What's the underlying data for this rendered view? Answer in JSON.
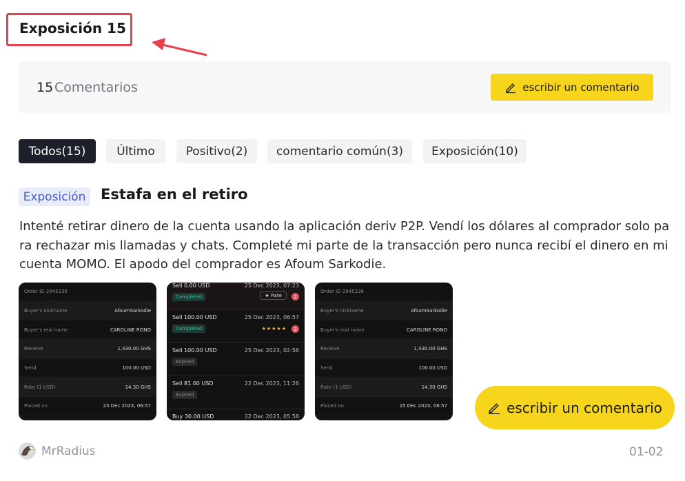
{
  "header": {
    "title": "Exposición 15"
  },
  "summary": {
    "count": "15",
    "count_label": "Comentarios",
    "write_button": "escribir un comentario"
  },
  "tabs": [
    {
      "label": "Todos(15)",
      "active": true
    },
    {
      "label": "Último",
      "active": false
    },
    {
      "label": "Positivo(2)",
      "active": false
    },
    {
      "label": "comentario común(3)",
      "active": false
    },
    {
      "label": "Exposición(10)",
      "active": false
    }
  ],
  "review": {
    "badge": "Exposición",
    "title": "Estafa en el retiro",
    "body": "Intenté retirar dinero de la cuenta usando la aplicación deriv P2P. Vendí los dólares al comprador solo para rechazar mis llamadas y chats. Completé mi parte de la transacción pero nunca recibí el dinero en mi cuenta MOMO. El apodo del comprador es Afoum Sarkodie.",
    "author": "MrRadius",
    "date": "01-02"
  },
  "screenshots": {
    "detail": {
      "header": "Order ID 2945336",
      "rows": [
        {
          "k": "Buyer's nickname",
          "v": "AfoumSarkodie"
        },
        {
          "k": "Buyer's real name",
          "v": "CAROLINE RONO"
        },
        {
          "k": "Receive",
          "v": "1,430.00 GHS"
        },
        {
          "k": "Send",
          "v": "100.00 USD"
        },
        {
          "k": "Rate (1 USD)",
          "v": "14.30 GHS"
        },
        {
          "k": "Placed on",
          "v": "25 Dec 2023, 06:57"
        }
      ]
    },
    "orders": {
      "top": {
        "title": "Sell 0.00 USD",
        "date": "25 Dec 2023, 07:23",
        "status": "Completed",
        "rate": "Rate",
        "badge": "2"
      },
      "items": [
        {
          "title": "Sell 100.00 USD",
          "date": "25 Dec 2023, 06:57",
          "status": "Completed",
          "stars": "★★★★★",
          "badge": "2"
        },
        {
          "title": "Sell 100.00 USD",
          "date": "25 Dec 2023, 02:56",
          "status": "Expired"
        },
        {
          "title": "Sell 81.00 USD",
          "date": "22 Dec 2023, 11:26",
          "status": "Expired"
        },
        {
          "title": "Buy 30.00 USD",
          "date": "22 Dec 2023, 05:58"
        }
      ]
    }
  },
  "floating": {
    "write_button": "escribir un comentario"
  },
  "colors": {
    "accent": "#f7d51d",
    "tab_active": "#1d1f2a",
    "highlight": "#e8404a",
    "badge_text": "#4a5bc4"
  },
  "icons": {
    "edit": "pencil-icon",
    "annotation": "arrow-icon",
    "avatar": "eagle-avatar"
  }
}
